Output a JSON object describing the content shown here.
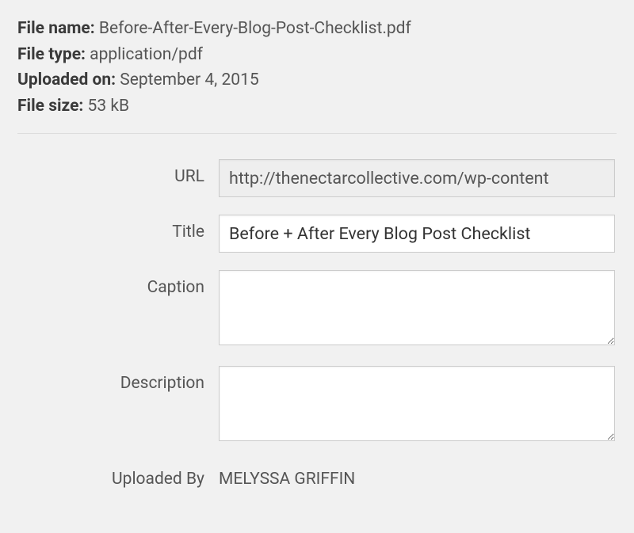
{
  "meta": {
    "file_name_label": "File name:",
    "file_name_value": "Before-After-Every-Blog-Post-Checklist.pdf",
    "file_type_label": "File type:",
    "file_type_value": "application/pdf",
    "uploaded_on_label": "Uploaded on:",
    "uploaded_on_value": "September 4, 2015",
    "file_size_label": "File size:",
    "file_size_value": "53 kB"
  },
  "form": {
    "url_label": "URL",
    "url_value": "http://thenectarcollective.com/wp-content",
    "title_label": "Title",
    "title_value": "Before + After Every Blog Post Checklist",
    "caption_label": "Caption",
    "caption_value": "",
    "description_label": "Description",
    "description_value": "",
    "uploaded_by_label": "Uploaded By",
    "uploaded_by_value": "MELYSSA GRIFFIN"
  }
}
